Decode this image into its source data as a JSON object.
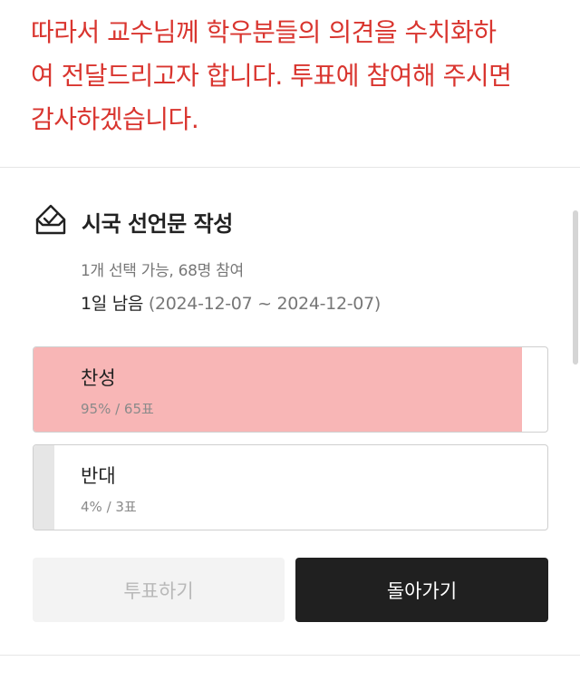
{
  "notice": {
    "line1": "따라서 교수님께 학우분들의 의견을 수치화하",
    "line2": "여 전달드리고자 합니다. 투표에 참여해 주시면",
    "line3": "감사하겠습니다."
  },
  "poll": {
    "title": "시국 선언문 작성",
    "meta": "1개 선택 가능, 68명 참여",
    "remaining": "1일 남음",
    "range": "(2024-12-07 ~ 2024-12-07)",
    "options": [
      {
        "label": "찬성",
        "result": "95% / 65표",
        "percent": 95
      },
      {
        "label": "반대",
        "result": "4% / 3표",
        "percent": 4
      }
    ]
  },
  "buttons": {
    "vote": "투표하기",
    "back": "돌아가기"
  },
  "colors": {
    "notice_text": "#d9352f",
    "leading_fill": "#f8b6b6",
    "other_fill": "#e6e6e6"
  },
  "icons": {
    "poll": "vote-check-icon"
  }
}
